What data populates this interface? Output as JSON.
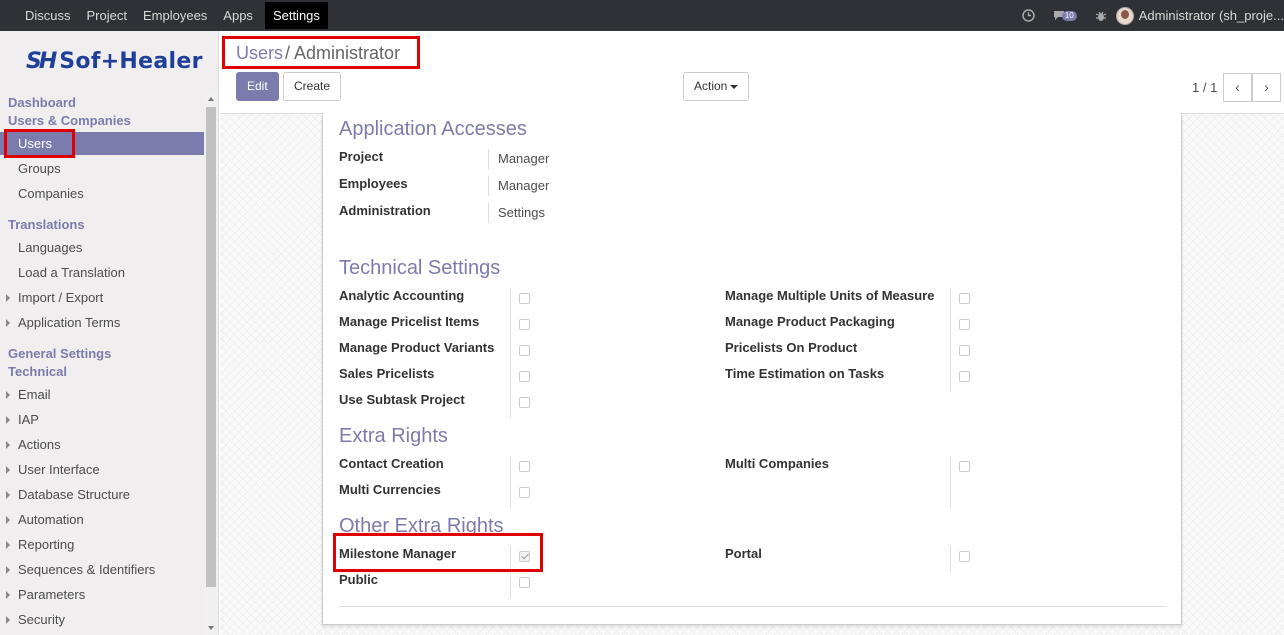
{
  "topbar": {
    "menu": [
      "Discuss",
      "Project",
      "Employees",
      "Apps",
      "Settings"
    ],
    "active": "Settings",
    "message_count": "10",
    "user": "Administrator (sh_proje..."
  },
  "logo": {
    "mark": "SH",
    "text": "Sof+Healer"
  },
  "sidebar": {
    "dashboard": "Dashboard",
    "users_companies": "Users & Companies",
    "users": "Users",
    "groups": "Groups",
    "companies": "Companies",
    "translations": "Translations",
    "languages": "Languages",
    "load_translation": "Load a Translation",
    "import_export": "Import / Export",
    "application_terms": "Application Terms",
    "general_settings": "General Settings",
    "technical": "Technical",
    "email": "Email",
    "iap": "IAP",
    "actions": "Actions",
    "user_interface": "User Interface",
    "database_structure": "Database Structure",
    "automation": "Automation",
    "reporting": "Reporting",
    "sequences": "Sequences & Identifiers",
    "parameters": "Parameters",
    "security": "Security"
  },
  "breadcrumb": {
    "parent": "Users",
    "separator": "/",
    "current": "Administrator"
  },
  "buttons": {
    "edit": "Edit",
    "create": "Create",
    "action": "Action"
  },
  "pager": {
    "value": "1 / 1",
    "prev": "‹",
    "next": "›"
  },
  "app_access": {
    "title": "Application Accesses",
    "project_label": "Project",
    "project_value": "Manager",
    "employees_label": "Employees",
    "employees_value": "Manager",
    "administration_label": "Administration",
    "administration_value": "Settings"
  },
  "technical_settings": {
    "title": "Technical Settings",
    "analytic": "Analytic Accounting",
    "pricelist_items": "Manage Pricelist Items",
    "product_variants": "Manage Product Variants",
    "sales_pricelists": "Sales Pricelists",
    "subtask": "Use Subtask Project",
    "units_measure": "Manage Multiple Units of Measure",
    "packaging": "Manage Product Packaging",
    "pricelists_product": "Pricelists On Product",
    "time_estimation": "Time Estimation on Tasks"
  },
  "extra_rights": {
    "title": "Extra Rights",
    "contact_creation": "Contact Creation",
    "multi_currencies": "Multi Currencies",
    "multi_companies": "Multi Companies"
  },
  "other_extra_rights": {
    "title": "Other Extra Rights",
    "milestone_manager": "Milestone Manager",
    "milestone_checked": true,
    "public": "Public",
    "portal": "Portal"
  }
}
